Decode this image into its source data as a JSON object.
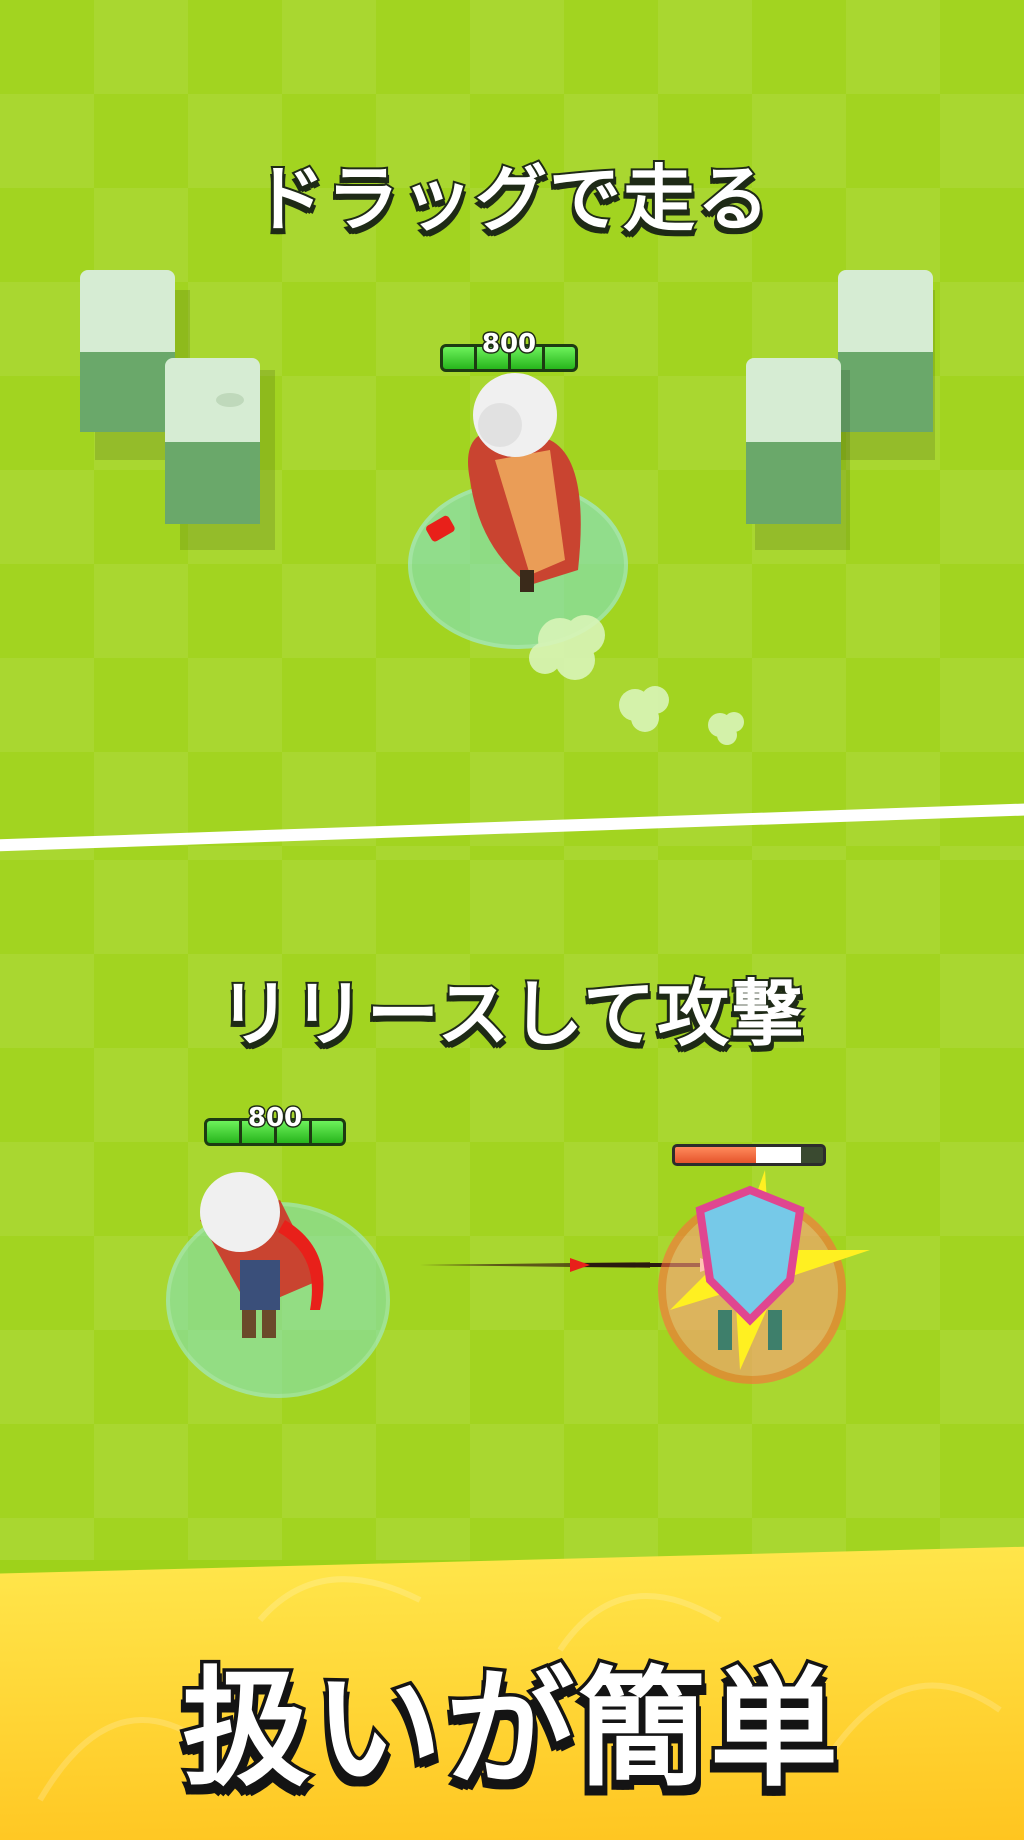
{
  "top_panel": {
    "caption": "ドラッグで走る",
    "player_hp": "800"
  },
  "bottom_panel": {
    "caption": "リリースして攻撃",
    "player_hp": "800",
    "enemy_hp_fraction": 0.55
  },
  "banner": {
    "caption": "扱いが簡単"
  },
  "colors": {
    "grass": "#a2d420",
    "hp_green": "#27b51c",
    "banner_yellow": "#ffd22e",
    "enemy_red": "#e5542b"
  }
}
